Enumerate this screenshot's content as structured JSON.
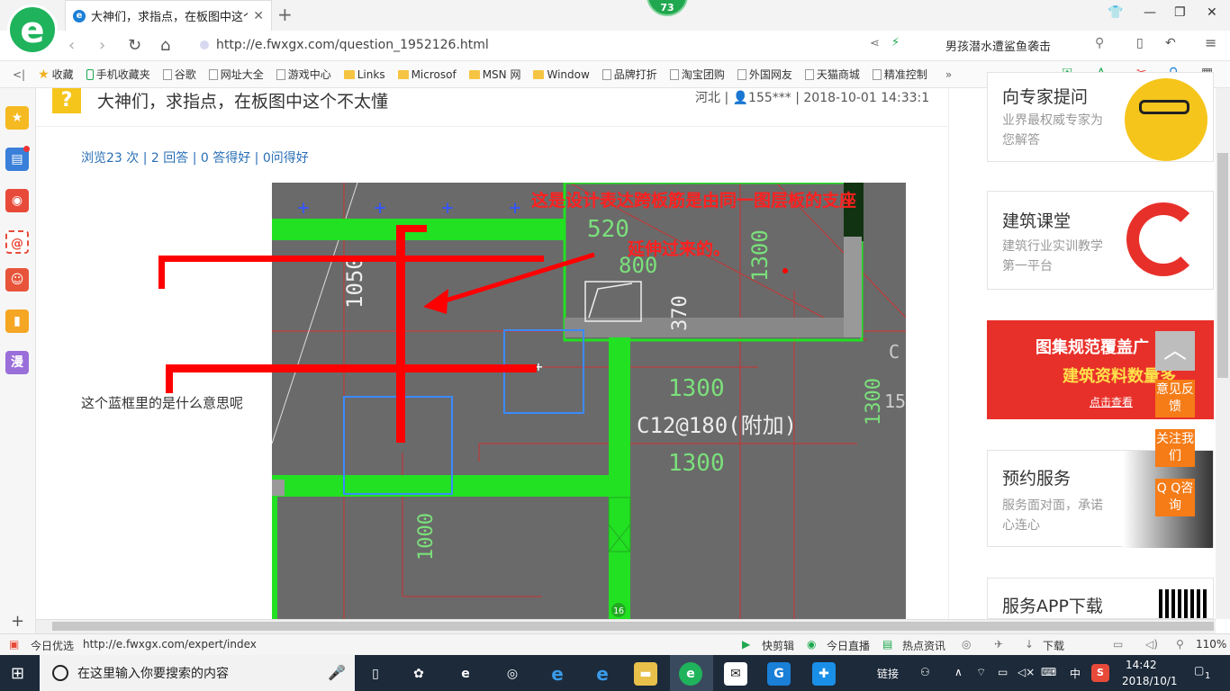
{
  "browser": {
    "tab_title": "大神们，求指点，在板图中这个不",
    "tab_badge": "73",
    "url": "http://e.fwxgx.com/question_1952126.html",
    "search_suggestion": "男孩潜水遭鲨鱼袭击"
  },
  "bookmarks": [
    {
      "label": "收藏",
      "icon": "star-icon"
    },
    {
      "label": "手机收藏夹",
      "icon": "phone-icon"
    },
    {
      "label": "谷歌",
      "icon": "page-icon"
    },
    {
      "label": "网址大全",
      "icon": "page-icon"
    },
    {
      "label": "游戏中心",
      "icon": "page-icon"
    },
    {
      "label": "Links",
      "icon": "folder-icon"
    },
    {
      "label": "Microsof",
      "icon": "folder-icon"
    },
    {
      "label": "MSN 网",
      "icon": "folder-icon"
    },
    {
      "label": "Window",
      "icon": "folder-icon"
    },
    {
      "label": "品牌打折",
      "icon": "page-icon"
    },
    {
      "label": "淘宝团购",
      "icon": "page-icon"
    },
    {
      "label": "外国网友",
      "icon": "page-icon"
    },
    {
      "label": "天猫商城",
      "icon": "page-icon"
    },
    {
      "label": "精准控制",
      "icon": "page-icon"
    }
  ],
  "question": {
    "title": "大神们，求指点，在板图中这个不太懂",
    "meta": "河北 | 👤155*** | 2018-10-01 14:33:1",
    "stats": "浏览23 次 | 2 回答 | 0 答得好 | 0问得好",
    "description": "这个蓝框里的是什么意思呢"
  },
  "drawing": {
    "annotation_line1": "这是设计表达跨板筋是由同一图层板的支座",
    "annotation_line2": "延伸过来的。",
    "dims": [
      "520",
      "800",
      "1050",
      "370",
      "1300",
      "1300",
      "1300",
      "1000",
      "1300",
      "C12@180(附加)",
      "16",
      "C",
      "15"
    ]
  },
  "sidebar_right": {
    "card0_title": "向专家提问",
    "card0_sub": "业界最权威专家为您解答",
    "card1_title": "建筑课堂",
    "card1_sub": "建筑行业实训教学第一平台",
    "banner_line1": "图集规范覆盖广",
    "banner_line2": "建筑资料数量多",
    "banner_btn": "点击查看",
    "card2_title": "预约服务",
    "card2_sub": "服务面对面，承诺心连心",
    "card3_title": "服务APP下载"
  },
  "float_buttons": {
    "feedback": "意见反馈",
    "follow": "关注我们",
    "qq": "Q Q咨询"
  },
  "statusbar": {
    "left": "今日优选",
    "url": "http://e.fwxgx.com/expert/index",
    "items": [
      "快剪辑",
      "今日直播",
      "热点资讯",
      "下载"
    ],
    "zoom": "110%"
  },
  "taskbar": {
    "search_placeholder": "在这里输入你要搜索的内容",
    "link_label": "链接",
    "ime": "中",
    "time": "14:42",
    "date": "2018/10/1",
    "notif": "1"
  },
  "colors": {
    "accent": "#1fb35c",
    "link": "#2a6fb5",
    "cad_bg": "#6a6a6a",
    "cad_green": "#22e022",
    "annotation_red": "#ff0000",
    "orange": "#f57c17"
  }
}
